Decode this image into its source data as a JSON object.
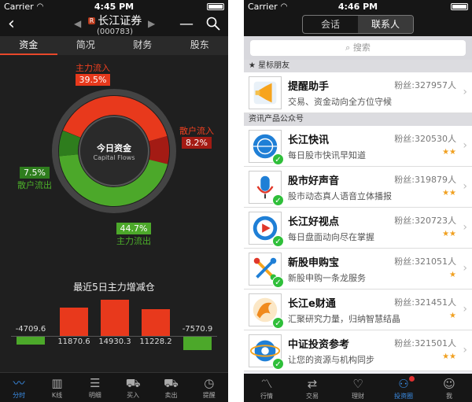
{
  "left": {
    "status": {
      "carrier": "Carrier",
      "time": "4:45 PM"
    },
    "header": {
      "badge": "R",
      "name": "长江证券",
      "code": "(000783)"
    },
    "tabs": [
      {
        "label": "资金",
        "active": true
      },
      {
        "label": "简况",
        "active": false
      },
      {
        "label": "财务",
        "active": false
      },
      {
        "label": "股东",
        "active": false
      }
    ],
    "donut": {
      "center_title": "今日资金",
      "center_sub": "Capital Flows",
      "main_in": {
        "label": "主力流入",
        "value": "39.5%"
      },
      "retail_in": {
        "label": "散户流入",
        "value": "8.2%"
      },
      "retail_out": {
        "label": "散户流出",
        "value": "7.5%"
      },
      "main_out": {
        "label": "主力流出",
        "value": "44.7%"
      },
      "segments": [
        {
          "name": "main_in",
          "fraction": 0.395,
          "color": "#e8391c"
        },
        {
          "name": "retail_in",
          "fraction": 0.082,
          "color": "#a31b14"
        },
        {
          "name": "main_out",
          "fraction": 0.447,
          "color": "#4ca82a"
        },
        {
          "name": "retail_out",
          "fraction": 0.075,
          "color": "#2e7d1d"
        }
      ]
    },
    "bar_title": "最近5日主力增减仓",
    "bars": [
      {
        "label": "-4709.6",
        "value": -4709.6
      },
      {
        "label": "11870.6",
        "value": 11870.6
      },
      {
        "label": "14930.3",
        "value": 14930.3
      },
      {
        "label": "11228.2",
        "value": 11228.2
      },
      {
        "label": "-7570.9",
        "value": -7570.9
      }
    ],
    "bottom_nav": [
      {
        "label": "分时",
        "icon": "chart-line-icon",
        "glyph": "〰",
        "active": true
      },
      {
        "label": "K线",
        "icon": "candlestick-icon",
        "glyph": "▥",
        "active": false
      },
      {
        "label": "明细",
        "icon": "list-icon",
        "glyph": "☰",
        "active": false
      },
      {
        "label": "买入",
        "icon": "cart-buy-icon",
        "glyph": "⛟",
        "active": false
      },
      {
        "label": "卖出",
        "icon": "cart-sell-icon",
        "glyph": "⛟",
        "active": false
      },
      {
        "label": "提醒",
        "icon": "alarm-icon",
        "glyph": "◷",
        "active": false
      }
    ]
  },
  "right": {
    "status": {
      "carrier": "Carrier",
      "time": "4:46 PM"
    },
    "segments": [
      {
        "label": "会话",
        "active": false
      },
      {
        "label": "联系人",
        "active": true
      }
    ],
    "search_placeholder": "搜索",
    "section_star": "星标朋友",
    "section_public": "资讯产品公众号",
    "star_items": [
      {
        "title": "提醒助手",
        "desc": "交易、资金动向全方位守候",
        "fans": "粉丝:327957人",
        "stars": "",
        "icon": "megaphone-icon"
      }
    ],
    "items": [
      {
        "title": "长江快讯",
        "desc": "每日股市快讯早知道",
        "fans": "粉丝:320530人",
        "stars": "★★",
        "icon": "globe-icon"
      },
      {
        "title": "股市好声音",
        "desc": "股市动态真人语音立体播报",
        "fans": "粉丝:319879人",
        "stars": "★★",
        "icon": "microphone-icon"
      },
      {
        "title": "长江好视点",
        "desc": "每日盘面动向尽在掌握",
        "fans": "粉丝:320723人",
        "stars": "★★",
        "icon": "play-icon"
      },
      {
        "title": "新股申购宝",
        "desc": "新股申购一条龙服务",
        "fans": "粉丝:321051人",
        "stars": "★",
        "icon": "network-icon"
      },
      {
        "title": "长江e财通",
        "desc": "汇聚研究力量，归纳智慧结晶",
        "fans": "粉丝:321451人",
        "stars": "★",
        "icon": "phoenix-icon"
      },
      {
        "title": "中证投资参考",
        "desc": "让您的资源与机构同步",
        "fans": "粉丝:321501人",
        "stars": "★★",
        "icon": "globe-orbit-icon"
      }
    ],
    "bottom_nav": [
      {
        "label": "行情",
        "icon": "market-icon",
        "glyph": "〽",
        "active": false
      },
      {
        "label": "交易",
        "icon": "trade-icon",
        "glyph": "⇄",
        "active": false
      },
      {
        "label": "理财",
        "icon": "handshake-icon",
        "glyph": "♡",
        "active": false
      },
      {
        "label": "投资圈",
        "icon": "people-icon",
        "glyph": "⚇",
        "active": true
      },
      {
        "label": "我",
        "icon": "user-icon",
        "glyph": "☺",
        "active": false
      }
    ]
  }
}
